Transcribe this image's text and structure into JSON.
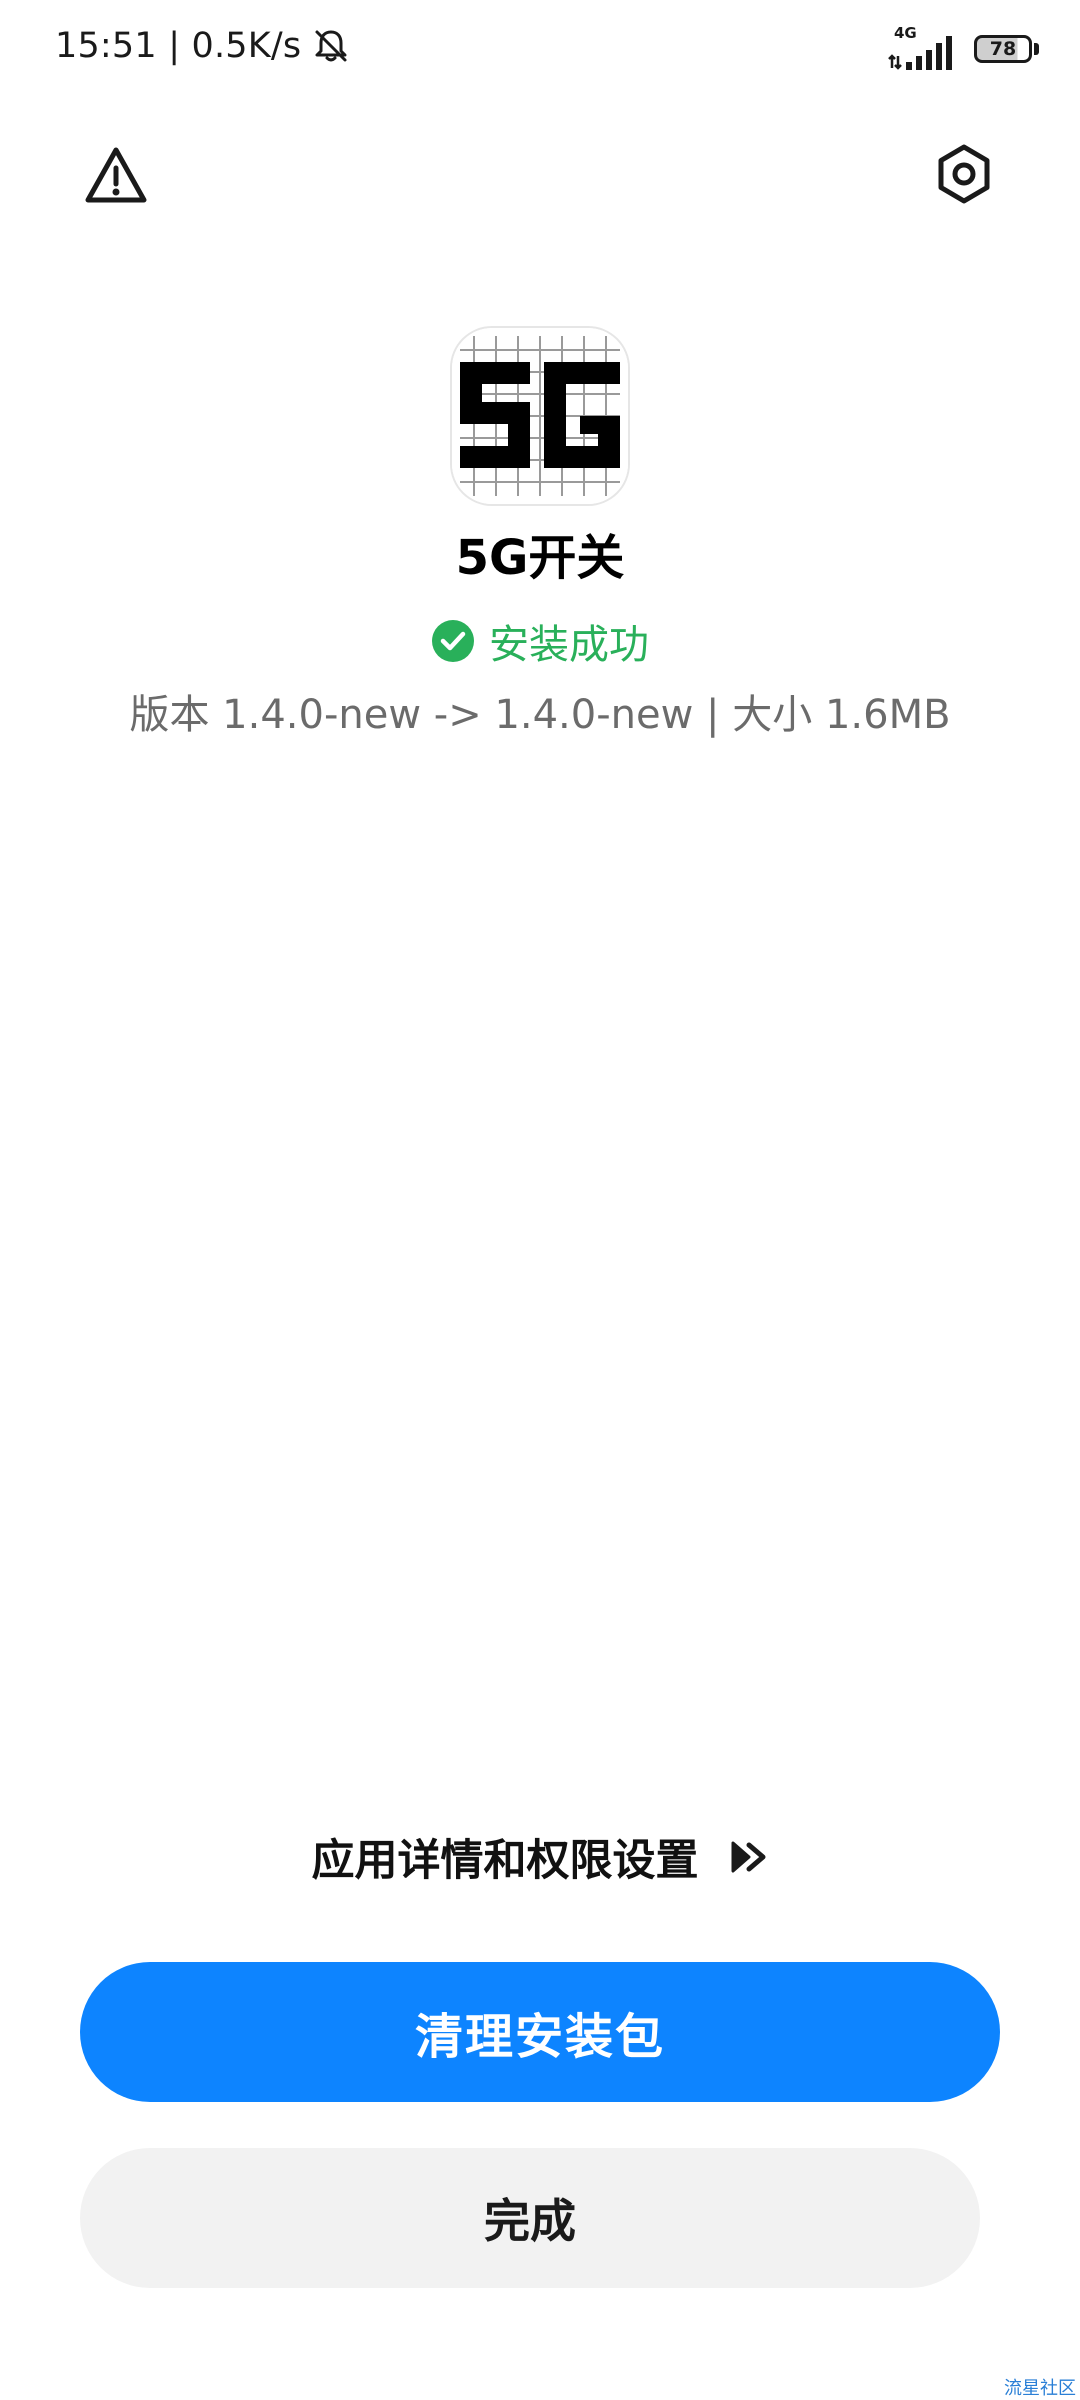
{
  "status_bar": {
    "time_speed": "15:51 | 0.5K/s",
    "network_type": "4G",
    "battery_level": "78",
    "icons": [
      "bell-muted-icon",
      "signal-icon",
      "battery-icon"
    ]
  },
  "toolbar": {
    "warning_icon": "warning-icon",
    "settings_icon": "settings-icon"
  },
  "app": {
    "name": "5G开关",
    "install_status": "安装成功",
    "version_info": "版本 1.4.0-new -> 1.4.0-new | 大小 1.6MB"
  },
  "actions": {
    "details_link": "应用详情和权限设置",
    "clean_button": "清理安装包",
    "done_button": "完成"
  },
  "watermark": "流星社区",
  "colors": {
    "accent": "#0d84ff",
    "success": "#29b05a"
  }
}
